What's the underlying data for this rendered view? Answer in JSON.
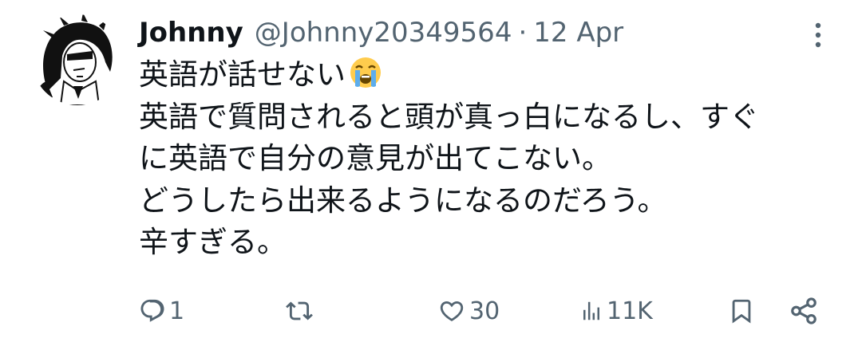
{
  "tweet": {
    "display_name": "Johnny",
    "handle": "@Johnny20349564",
    "separator": "·",
    "timestamp": "12 Apr",
    "lines": [
      "英語が話せない",
      "英語で質問されると頭が真っ白になるし、すぐ",
      "に英語で自分の意見が出てこない。",
      "どうしたら出来るようになるのだろう。",
      "辛すぎる。"
    ],
    "emoji": "loudly-crying-face"
  },
  "actions": {
    "reply_count": "1",
    "retweet_count": "",
    "like_count": "30",
    "view_count": "11K"
  },
  "colors": {
    "text": "#0f1419",
    "muted": "#536471",
    "background": "#ffffff"
  },
  "icons": [
    "more-vert-icon",
    "reply-icon",
    "retweet-icon",
    "like-icon",
    "views-icon",
    "bookmark-icon",
    "share-icon"
  ]
}
